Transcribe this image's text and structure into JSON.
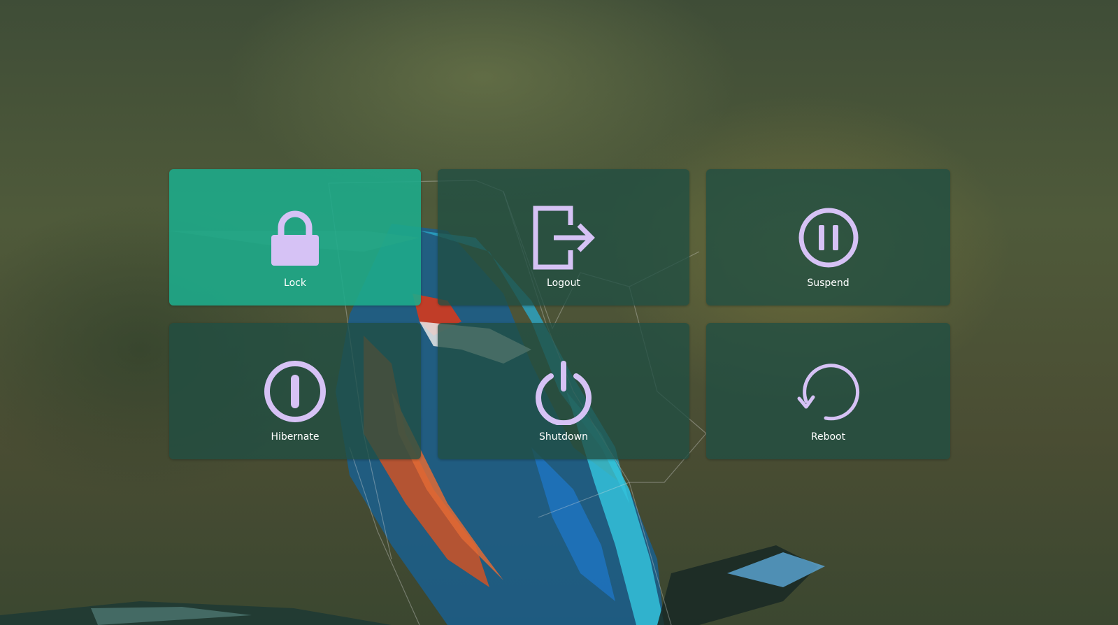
{
  "power_menu": {
    "accent_color": "#d6c2f5",
    "selected_tile_color": "#1eaa8a",
    "tile_color": "#204e42",
    "items": [
      {
        "label": "Lock",
        "icon": "lock-icon",
        "selected": true
      },
      {
        "label": "Logout",
        "icon": "logout-icon",
        "selected": false
      },
      {
        "label": "Suspend",
        "icon": "pause-icon",
        "selected": false
      },
      {
        "label": "Hibernate",
        "icon": "hibernate-icon",
        "selected": false
      },
      {
        "label": "Shutdown",
        "icon": "power-icon",
        "selected": false
      },
      {
        "label": "Reboot",
        "icon": "reboot-icon",
        "selected": false
      }
    ]
  }
}
